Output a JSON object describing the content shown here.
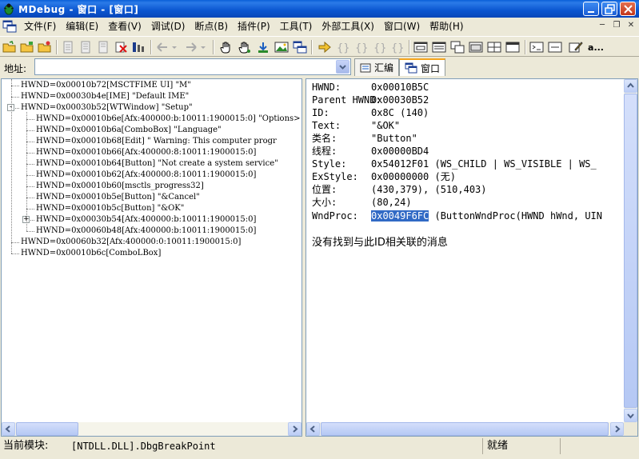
{
  "window": {
    "title": "MDebug - 窗口 - [窗口]"
  },
  "menu": {
    "items": [
      "文件(F)",
      "编辑(E)",
      "查看(V)",
      "调试(D)",
      "断点(B)",
      "插件(P)",
      "工具(T)",
      "外部工具(X)",
      "窗口(W)",
      "帮助(H)"
    ]
  },
  "toolbar": {
    "more_label": "a..."
  },
  "address": {
    "label": "地址:",
    "value": ""
  },
  "tabs": [
    {
      "label": "汇编",
      "icon": "assembly-icon",
      "active": false
    },
    {
      "label": "窗口",
      "icon": "window-icon",
      "active": true
    }
  ],
  "tree": {
    "rows": [
      {
        "level": 0,
        "text": "HWND=0x00010b72[MSCTFIME UI] \"M\"",
        "expander": ""
      },
      {
        "level": 0,
        "text": "HWND=0x00030b4e[IME] \"Default IME\"",
        "expander": ""
      },
      {
        "level": 0,
        "text": "HWND=0x00030b52[WTWindow] \"Setup\"",
        "expander": "-"
      },
      {
        "level": 1,
        "text": "HWND=0x00010b6e[Afx:400000:b:10011:1900015:0] \"Options>",
        "expander": ""
      },
      {
        "level": 1,
        "text": "HWND=0x00010b6a[ComboBox] \"Language\"",
        "expander": ""
      },
      {
        "level": 1,
        "text": "HWND=0x00010b68[Edit] \"    Warning: This computer progr",
        "expander": ""
      },
      {
        "level": 1,
        "text": "HWND=0x00010b66[Afx:400000:8:10011:1900015:0]",
        "expander": ""
      },
      {
        "level": 1,
        "text": "HWND=0x00010b64[Button] \"Not create a system service\"",
        "expander": ""
      },
      {
        "level": 1,
        "text": "HWND=0x00010b62[Afx:400000:8:10011:1900015:0]",
        "expander": ""
      },
      {
        "level": 1,
        "text": "HWND=0x00010b60[msctls_progress32]",
        "expander": ""
      },
      {
        "level": 1,
        "text": "HWND=0x00010b5e[Button] \"&Cancel\"",
        "expander": ""
      },
      {
        "level": 1,
        "text": "HWND=0x00010b5c[Button] \"&OK\"",
        "expander": ""
      },
      {
        "level": 1,
        "text": "HWND=0x00030b54[Afx:400000:b:10011:1900015:0]",
        "expander": "+"
      },
      {
        "level": 1,
        "text": "HWND=0x00060b48[Afx:400000:b:10011:1900015:0]",
        "expander": ""
      },
      {
        "level": 0,
        "text": "HWND=0x00060b32[Afx:400000:0:10011:1900015:0]",
        "expander": ""
      },
      {
        "level": 0,
        "text": "HWND=0x00010b6c[ComboLBox]",
        "expander": ""
      }
    ]
  },
  "details": {
    "rows": [
      {
        "label": "HWND:",
        "value": "0x00010B5C"
      },
      {
        "label": "Parent HWND:",
        "value": "0x00030B52"
      },
      {
        "label": "ID:",
        "value": "0x8C (140)"
      },
      {
        "label": "Text:",
        "value": "\"&OK\""
      },
      {
        "label": "类名:",
        "value": "\"Button\""
      },
      {
        "label": "线程:",
        "value": "0x00000BD4"
      },
      {
        "label": "Style:",
        "value": "0x54012F01  (WS_CHILD | WS_VISIBLE | WS_"
      },
      {
        "label": "ExStyle:",
        "value": "0x00000000  (无)"
      },
      {
        "label": "位置:",
        "value": "(430,379), (510,403)"
      },
      {
        "label": "大小:",
        "value": "(80,24)"
      }
    ],
    "wndproc_label": "WndProc:",
    "wndproc_selected": "0x0049F6FC",
    "wndproc_rest": " (ButtonWndProc(HWND hWnd, UIN",
    "no_message": "没有找到与此ID相关联的消息"
  },
  "status": {
    "module_label": "当前模块:",
    "module_value": "[NTDLL.DLL].DbgBreakPoint",
    "state": "就绪"
  }
}
